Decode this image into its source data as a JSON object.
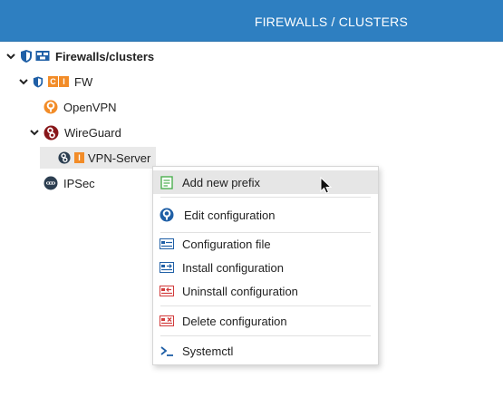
{
  "header": {
    "title": "FIREWALLS / CLUSTERS"
  },
  "tree": {
    "root_label": "Firewalls/clusters",
    "fw_label": "FW",
    "fw_badge_c": "C",
    "fw_badge_i": "I",
    "openvpn_label": "OpenVPN",
    "wireguard_label": "WireGuard",
    "vpnserver_label": "VPN-Server",
    "vpnserver_badge": "I",
    "ipsec_label": "IPSec"
  },
  "context_menu": {
    "items": [
      {
        "label": "Add new prefix",
        "icon": "add-prefix-icon"
      },
      {
        "label": "Edit configuration",
        "icon": "openvpn-edit-icon"
      },
      {
        "label": "Configuration file",
        "icon": "config-file-icon"
      },
      {
        "label": "Install configuration",
        "icon": "install-config-icon"
      },
      {
        "label": "Uninstall configuration",
        "icon": "uninstall-config-icon"
      },
      {
        "label": "Delete configuration",
        "icon": "delete-config-icon"
      },
      {
        "label": "Systemctl",
        "icon": "terminal-icon"
      }
    ]
  },
  "colors": {
    "header_bg": "#2e7fc1",
    "accent_blue": "#1f5fa6",
    "orange": "#f28c28",
    "wireguard_red": "#88171a",
    "danger_red": "#d23a3a",
    "ipsec_dark": "#2c3e50"
  }
}
